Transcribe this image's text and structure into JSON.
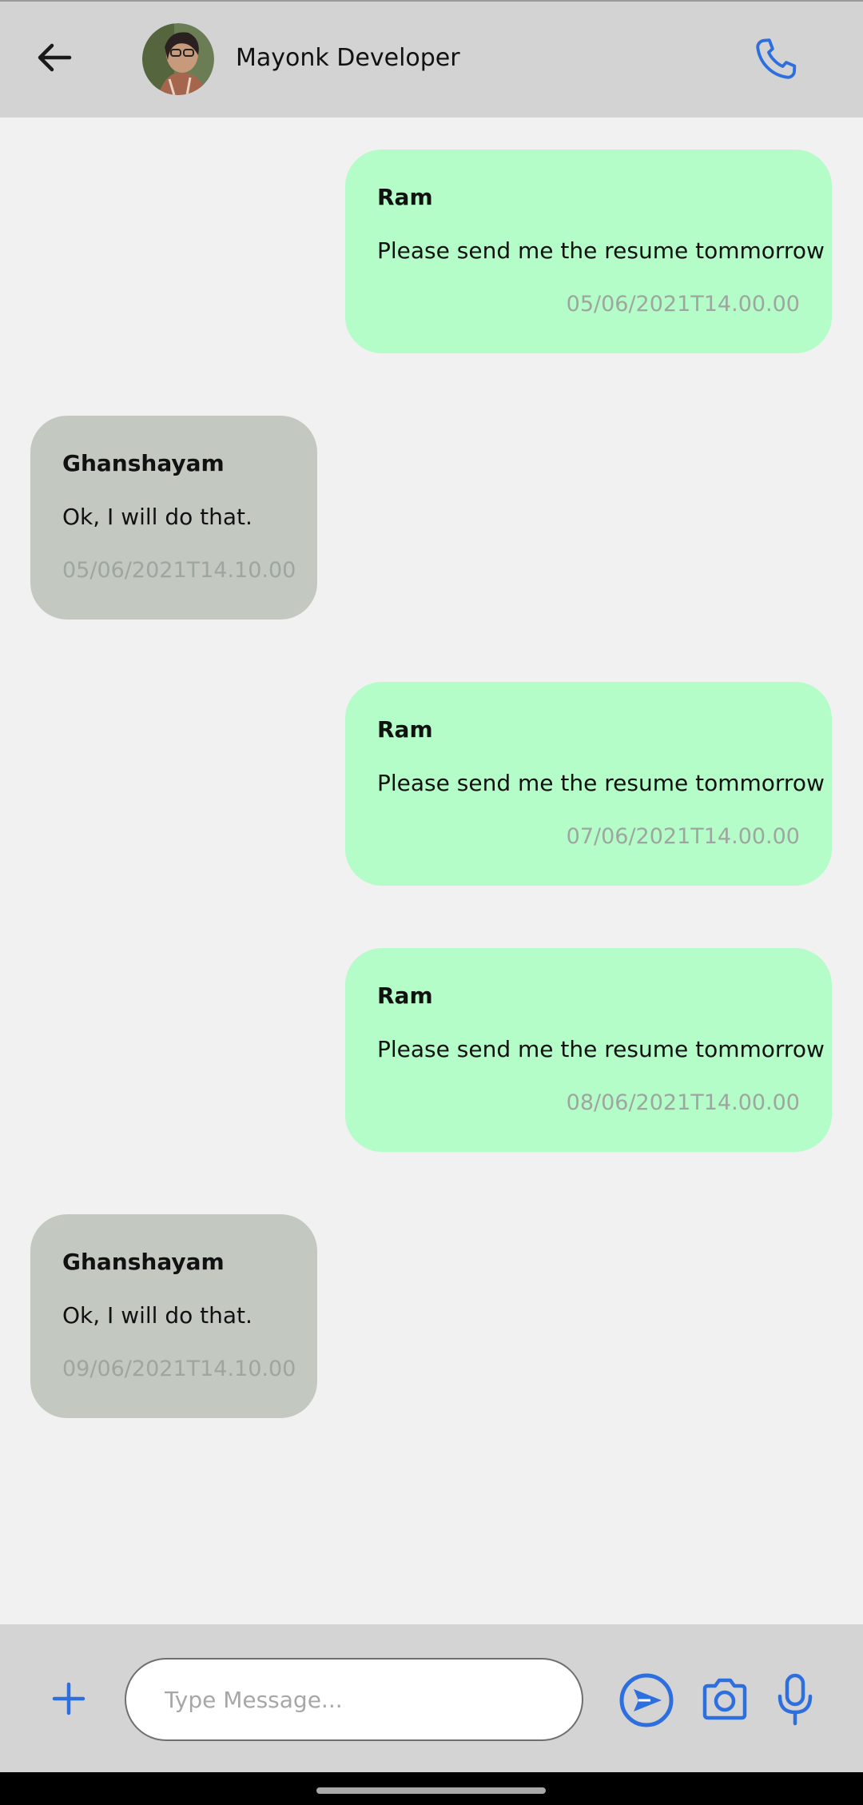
{
  "header": {
    "contact_name": "Mayonk Developer",
    "back_icon": "arrow-left-icon",
    "call_icon": "phone-icon",
    "accent_color": "#2e6fe0"
  },
  "messages": [
    {
      "direction": "outgoing",
      "sender": "Ram",
      "text": "Please send me the resume tommorrow",
      "time": "05/06/2021T14.00.00"
    },
    {
      "direction": "incoming",
      "sender": "Ghanshayam",
      "text": "Ok, I will do that.",
      "time": "05/06/2021T14.10.00"
    },
    {
      "direction": "outgoing",
      "sender": "Ram",
      "text": "Please send me the resume tommorrow",
      "time": "07/06/2021T14.00.00"
    },
    {
      "direction": "outgoing",
      "sender": "Ram",
      "text": "Please send me the resume tommorrow",
      "time": "08/06/2021T14.00.00"
    },
    {
      "direction": "incoming",
      "sender": "Ghanshayam",
      "text": "Ok, I will do that.",
      "time": "09/06/2021T14.10.00"
    }
  ],
  "colors": {
    "outgoing_bubble": "#b4fcc8",
    "incoming_bubble": "#c3c8c1",
    "timestamp": "#9ea6a0"
  },
  "composer": {
    "placeholder": "Type Message...",
    "value": "",
    "icons": [
      "plus-icon",
      "send-icon",
      "camera-icon",
      "mic-icon"
    ]
  }
}
